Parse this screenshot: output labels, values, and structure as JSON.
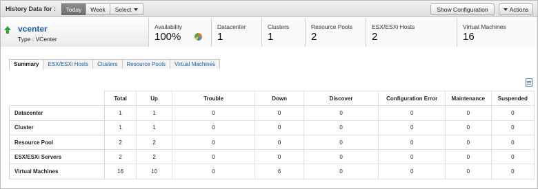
{
  "toolbar": {
    "title": "History Data for :",
    "range_buttons": [
      "Today",
      "Week"
    ],
    "select_label": "Select",
    "show_config_label": "Show Configuration",
    "actions_label": "Actions"
  },
  "entity": {
    "name": "vcenter",
    "type_label": "Type : VCenter",
    "status": "up"
  },
  "stats": [
    {
      "label": "Availability",
      "value": "100%"
    },
    {
      "label": "Datacenter",
      "value": "1"
    },
    {
      "label": "Clusters",
      "value": "1"
    },
    {
      "label": "Resource Pools",
      "value": "2"
    },
    {
      "label": "ESX/ESXi Hosts",
      "value": "2"
    },
    {
      "label": "Virtual Machines",
      "value": "16"
    }
  ],
  "tabs": [
    "Summary",
    "ESX/ESXi Hosts",
    "Clusters",
    "Resource Pools",
    "Virtual Machines"
  ],
  "table": {
    "columns": [
      "Total",
      "Up",
      "Trouble",
      "Down",
      "Discover",
      "Configuration Error",
      "Maintenance",
      "Suspended"
    ],
    "rows": [
      {
        "label": "Datacenter",
        "values": [
          "1",
          "1",
          "0",
          "0",
          "0",
          "0",
          "0",
          "0"
        ]
      },
      {
        "label": "Cluster",
        "values": [
          "1",
          "1",
          "0",
          "0",
          "0",
          "0",
          "0",
          "0"
        ]
      },
      {
        "label": "Resource Pool",
        "values": [
          "2",
          "2",
          "0",
          "0",
          "0",
          "0",
          "0",
          "0"
        ]
      },
      {
        "label": "ESX/ESXi Servers",
        "values": [
          "2",
          "2",
          "0",
          "0",
          "0",
          "0",
          "0",
          "0"
        ]
      },
      {
        "label": "Virtual Machines",
        "values": [
          "16",
          "10",
          "0",
          "6",
          "0",
          "0",
          "0",
          "0"
        ]
      }
    ]
  }
}
